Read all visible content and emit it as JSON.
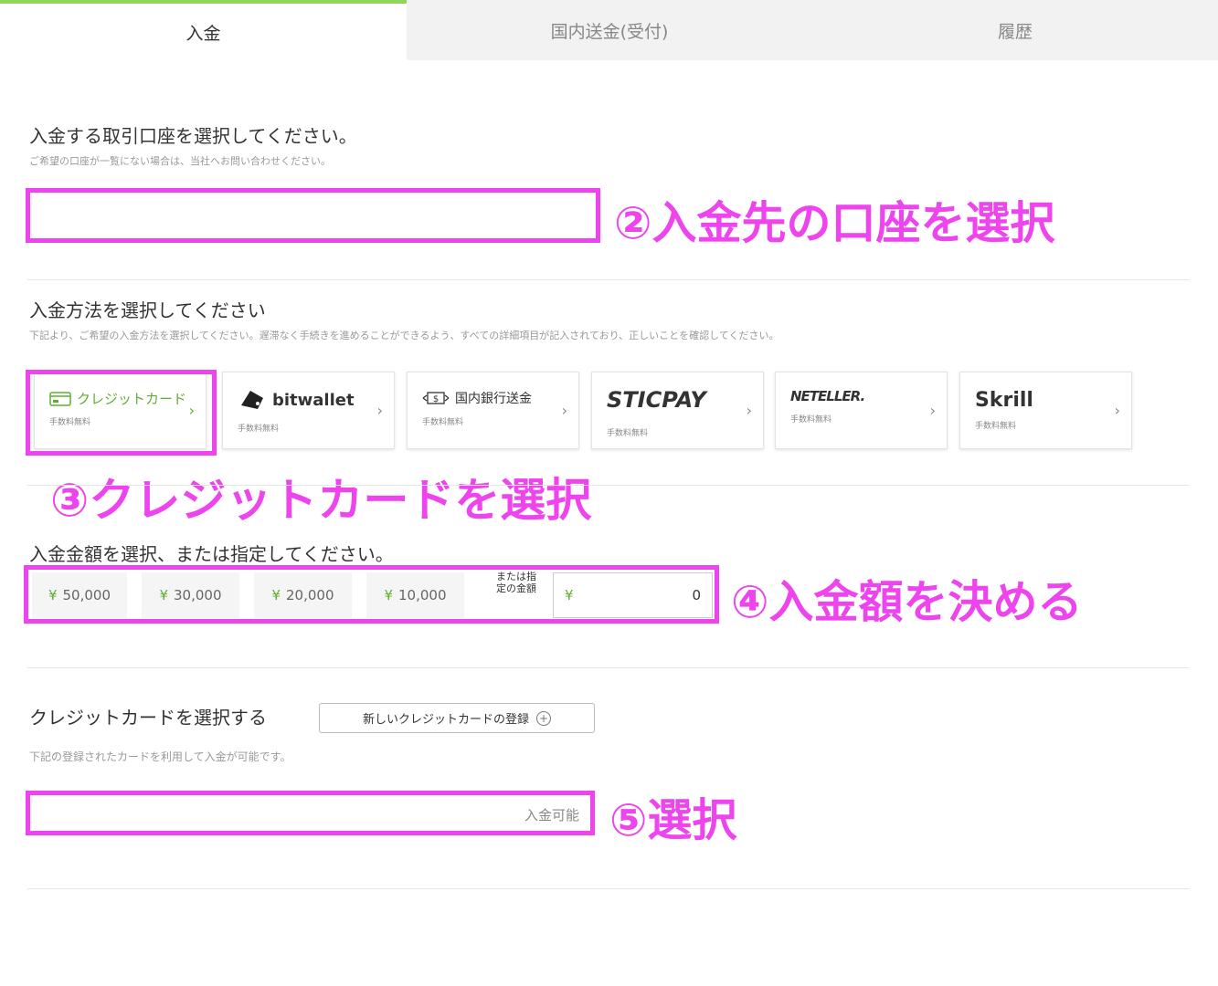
{
  "tabs": [
    {
      "label": "入金"
    },
    {
      "label": "国内送金(受付)"
    },
    {
      "label": "履歴"
    }
  ],
  "account": {
    "title": "入金する取引口座を選択してください。",
    "note": "ご希望の口座が一覧にない場合は、当社へお問い合わせください。",
    "annotation": "②入金先の口座を選択"
  },
  "method": {
    "title": "入金方法を選択してください",
    "note": "下記より、ご希望の入金方法を選択してください。遅滞なく手続きを進めることができるよう、すべての詳細項目が記入されており、正しいことを確認してください。",
    "options": [
      {
        "label": "クレジットカード",
        "fee": "手数料無料"
      },
      {
        "label": "bitwallet",
        "fee": "手数料無料"
      },
      {
        "label": "国内銀行送金",
        "fee": "手数料無料"
      },
      {
        "label": "STICPAY",
        "fee": "手数料無料"
      },
      {
        "label": "NETELLER.",
        "fee": "手数料無料"
      },
      {
        "label": "Skrill",
        "fee": "手数料無料"
      }
    ],
    "annotation": "③クレジットカードを選択"
  },
  "amount": {
    "title": "入金金額を選択、または指定してください。",
    "currency": "¥",
    "presets": [
      "50,000",
      "30,000",
      "20,000",
      "10,000"
    ],
    "or_label": "または指定の金額",
    "custom_value": "0",
    "annotation": "④入金額を決める"
  },
  "card": {
    "title": "クレジットカードを選択する",
    "new_button": "新しいクレジットカードの登録",
    "note": "下記の登録されたカードを利用して入金が可能です。",
    "status": "入金可能",
    "annotation": "⑤選択"
  },
  "colors": {
    "accent": "#5cb030",
    "highlight": "#ee44ee"
  }
}
